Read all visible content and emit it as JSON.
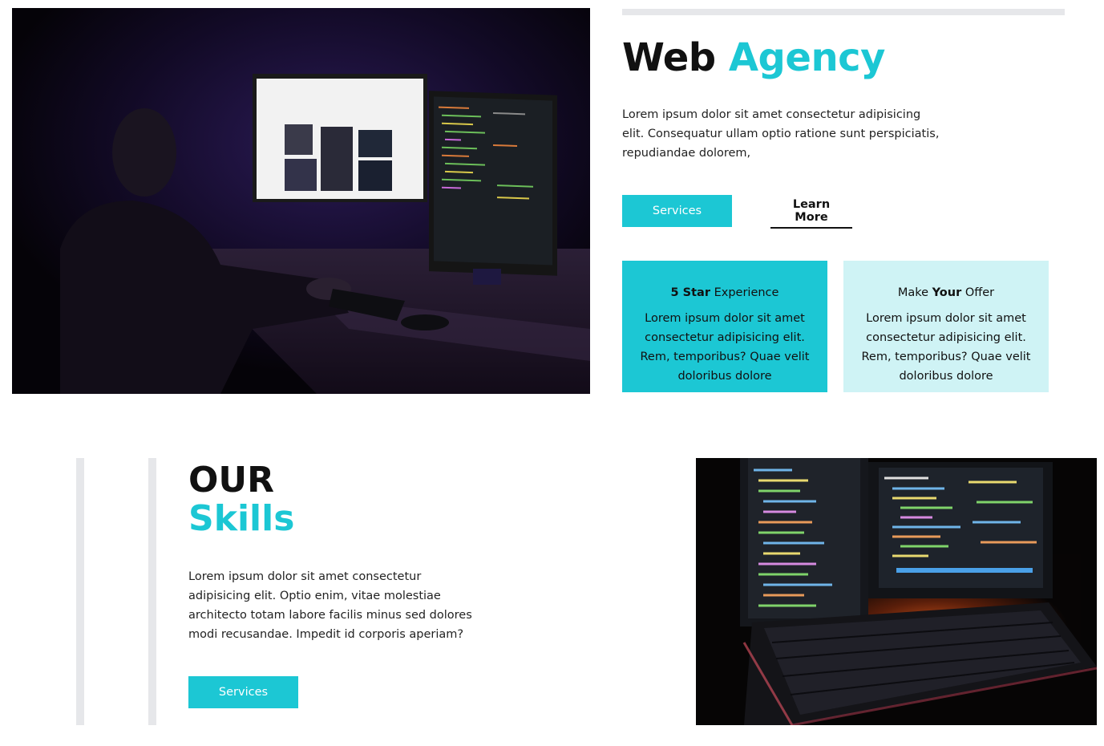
{
  "hero": {
    "image_alt": "Developer working at dual monitors in a dark room",
    "title_part1": "Web",
    "title_part2": "Agency",
    "text": "Lorem ipsum dolor sit amet consectetur adipisicing elit. Consequatur ullam optio ratione sunt perspiciatis, repudiandae dolorem,",
    "services_label": "Services",
    "learn_more_label": "Learn More"
  },
  "cards": [
    {
      "title_bold": "5 Star",
      "title_rest": " Experience",
      "body": "Lorem ipsum dolor sit amet consectetur adipisicing elit. Rem, temporibus? Quae velit doloribus dolore"
    },
    {
      "title_pre": "Make ",
      "title_bold": "Your",
      "title_rest": " Offer",
      "body": "Lorem ipsum dolor sit amet consectetur adipisicing elit. Rem, temporibus? Quae velit doloribus dolore"
    }
  ],
  "skills": {
    "title_line1": "OUR",
    "title_line2": "Skills",
    "text": "Lorem ipsum dolor sit amet consectetur adipisicing elit. Optio enim, vitae molestiae architecto totam labore facilis minus sed dolores modi recusandae. Impedit id corporis aperiam?",
    "services_label": "Services",
    "image_alt": "Laptop and monitor displaying code with glowing keyboard"
  },
  "colors": {
    "accent": "#1cc7d4",
    "accent_light": "#cff3f5",
    "bar_gray": "#e6e7ea",
    "text_dark": "#111111"
  }
}
